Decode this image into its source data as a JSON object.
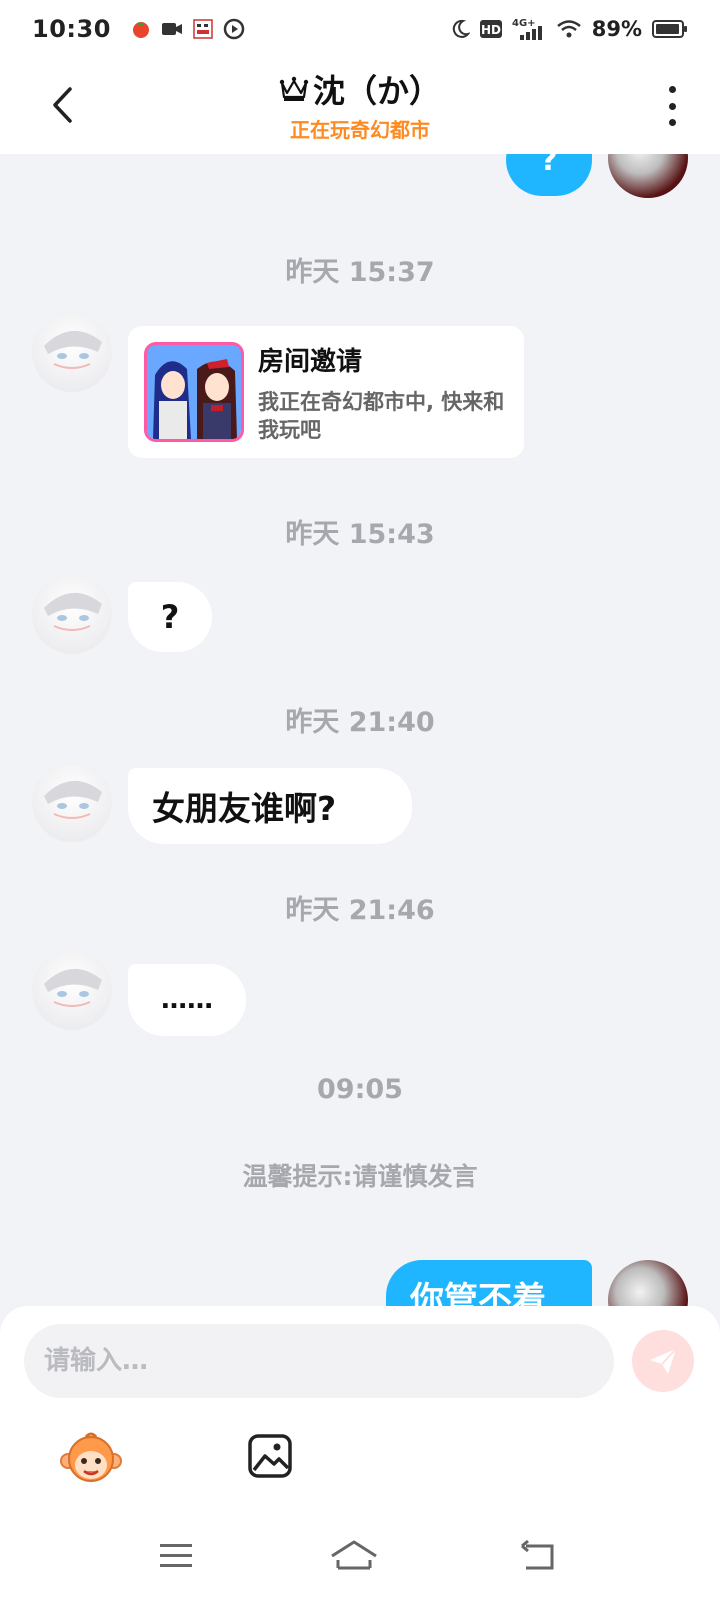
{
  "status_bar": {
    "time": "10:30",
    "battery_percent": "89%",
    "network": "4G+",
    "icons": [
      "tomato-app-icon",
      "video-camera-icon",
      "calendar-app-icon",
      "play-icon",
      "moon-icon",
      "hd-icon",
      "signal-icon",
      "wifi-icon",
      "battery-icon"
    ]
  },
  "header": {
    "title": "沈（か）",
    "crown_icon": "crown-icon",
    "subtitle": "正在玩奇幻都市"
  },
  "messages": {
    "top_partial_out": "?",
    "time_1": "昨天 15:37",
    "invite_title": "房间邀请",
    "invite_desc": "我正在奇幻都市中, 快来和我玩吧",
    "time_2": "昨天 15:43",
    "msg_2": "?",
    "time_3": "昨天 21:40",
    "msg_3": "女朋友谁啊?",
    "time_4": "昨天 21:46",
    "msg_4": "……",
    "time_5": "09:05",
    "notice": "温馨提示:请谨慎发言",
    "msg_out": "你管不着"
  },
  "input": {
    "placeholder": "请输入…"
  },
  "colors": {
    "accent_blue": "#1fb6ff",
    "subtitle_orange": "#ff8a1f",
    "send_button": "#ffdede",
    "background": "#f2f3f7"
  }
}
